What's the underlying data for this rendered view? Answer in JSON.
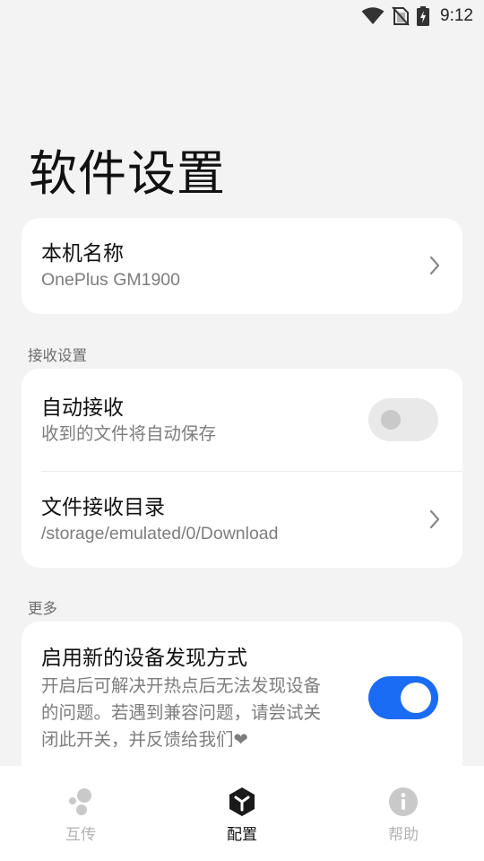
{
  "status_bar": {
    "time": "9:12"
  },
  "page_title": "软件设置",
  "device_name": {
    "title": "本机名称",
    "value": "OnePlus GM1900"
  },
  "receive_section": {
    "label": "接收设置",
    "auto_receive": {
      "title": "自动接收",
      "subtitle": "收到的文件将自动保存",
      "enabled": false
    },
    "receive_dir": {
      "title": "文件接收目录",
      "value": "/storage/emulated/0/Download"
    }
  },
  "more_section": {
    "label": "更多",
    "new_discovery": {
      "title": "启用新的设备发现方式",
      "desc_line1": "开启后可解决开热点后无法发现设备",
      "desc_line2": "的问题。若遇到兼容问题，请尝试关",
      "desc_line3": "闭此开关，并反馈给我们❤",
      "enabled": true
    }
  },
  "bottom_nav": {
    "items": [
      {
        "label": "互传",
        "icon": "bubbles-icon",
        "active": false
      },
      {
        "label": "配置",
        "icon": "cube-icon",
        "active": true
      },
      {
        "label": "帮助",
        "icon": "info-icon",
        "active": false
      }
    ]
  },
  "colors": {
    "accent": "#1a6cf5",
    "background": "#f3f3f3"
  }
}
